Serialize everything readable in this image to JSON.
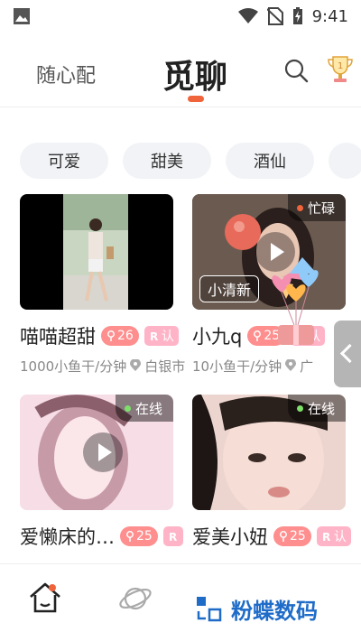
{
  "status_bar": {
    "time": "9:41"
  },
  "header": {
    "tab_left": "随心配",
    "tab_active": "觅聊"
  },
  "chips": [
    "可爱",
    "甜美",
    "酒仙"
  ],
  "cards": [
    {
      "name": "喵喵超甜",
      "age": "26",
      "cert": "认",
      "price": "1000小鱼干/分钟",
      "location": "白银市",
      "status": "",
      "video_tag": ""
    },
    {
      "name": "小九q",
      "age": "25",
      "cert": "认",
      "price": "10小鱼干/分钟",
      "location": "广",
      "status": "忙碌",
      "video_tag": "小清新"
    },
    {
      "name": "爱懒床的…",
      "age": "25",
      "cert": "",
      "price": "",
      "location": "",
      "status": "在线",
      "video_tag": ""
    },
    {
      "name": "爱美小妞",
      "age": "25",
      "cert": "认",
      "price": "",
      "location": "",
      "status": "在线",
      "video_tag": ""
    }
  ],
  "colors": {
    "accent": "#f0643c",
    "busy": "#f0643c",
    "online": "#7ee06a"
  },
  "watermark": {
    "text": "粉蝶数码"
  }
}
